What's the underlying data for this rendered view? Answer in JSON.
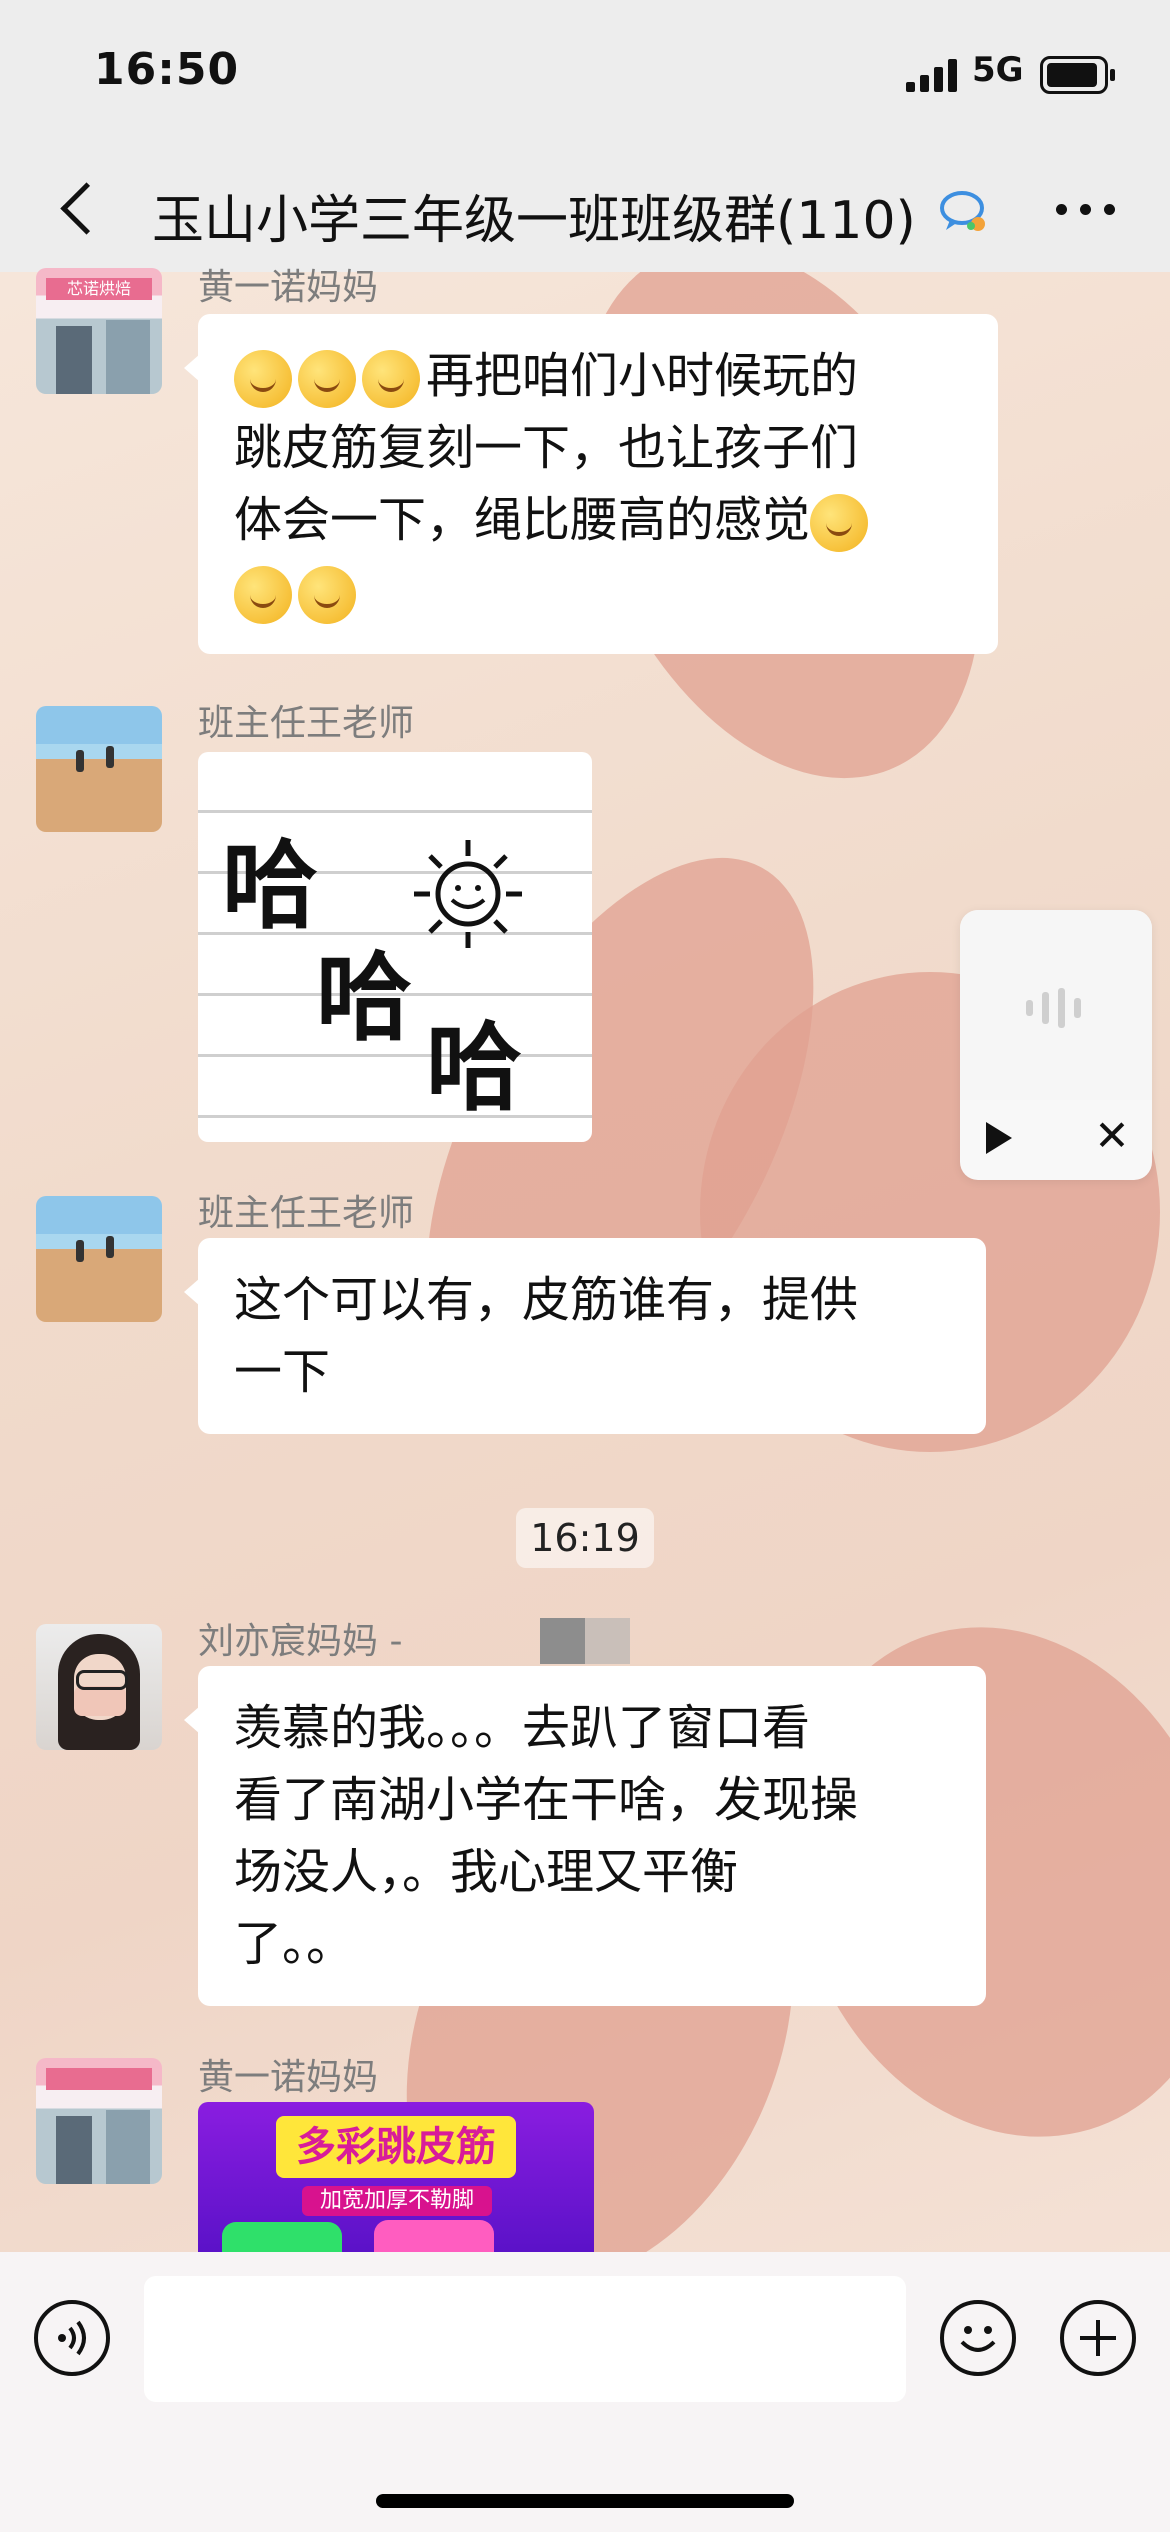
{
  "status_bar": {
    "time": "16:50",
    "network": "5G"
  },
  "nav": {
    "title": "玉山小学三年级一班班级群(110)"
  },
  "messages": [
    {
      "sender": "黄一诺妈妈",
      "lines": [
        "再把咱们小时候玩的",
        "跳皮筋复刻一下，也让孩子们",
        "体会一下，绳比腰高的感觉"
      ]
    },
    {
      "sender": "班主任王老师",
      "sticker_text": [
        "哈",
        "哈",
        "哈"
      ]
    },
    {
      "sender": "班主任王老师",
      "lines": [
        "这个可以有，皮筋谁有，提供",
        "一下"
      ]
    },
    {
      "sender": "刘亦宸妈妈 -",
      "lines": [
        "羡慕的我。。。去趴了窗口看",
        "看了南湖小学在干啥，发现操",
        "场没人，。我心理又平衡",
        "了。。"
      ]
    },
    {
      "sender": "黄一诺妈妈",
      "card_title": "多彩跳皮筋",
      "card_subtitle": "加宽加厚不勒脚"
    }
  ],
  "timestamp": "16:19",
  "avatar_sign": "芯诺烘焙",
  "voice_panel": {
    "play_icon": "play-icon",
    "close_icon": "close-icon",
    "close_glyph": "✕"
  },
  "input_bar": {
    "voice_icon": "voice-icon",
    "emoji_icon": "emoji-icon",
    "plus_icon": "plus-icon",
    "placeholder": ""
  },
  "colors": {
    "bubble": "#ffffff",
    "nav_bg": "#ededed",
    "accent_sticker": "#ff5dc0"
  }
}
